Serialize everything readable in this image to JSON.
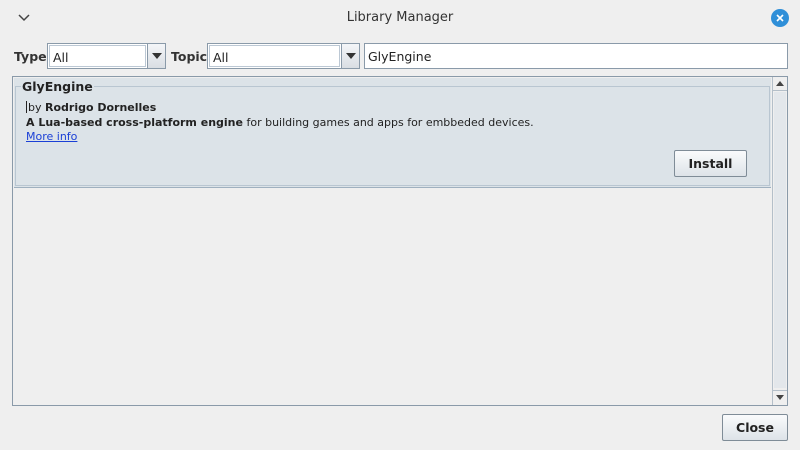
{
  "window": {
    "title": "Library Manager",
    "menu_icon": "chevron-down-icon",
    "close_icon": "close-icon",
    "close_color": "#2f8fd8"
  },
  "filters": {
    "type_label": "Type",
    "type_value": "All",
    "topic_label": "Topic",
    "topic_value": "All",
    "search_value": "GlyEngine"
  },
  "library": {
    "name": "GlyEngine",
    "by_prefix": "by",
    "author": "Rodrigo Dornelles",
    "summary_bold": "A Lua-based cross-platform engine",
    "summary_rest": " for building games and apps for embbeded devices.",
    "more_info": "More info",
    "install_label": "Install"
  },
  "footer": {
    "close_label": "Close"
  }
}
